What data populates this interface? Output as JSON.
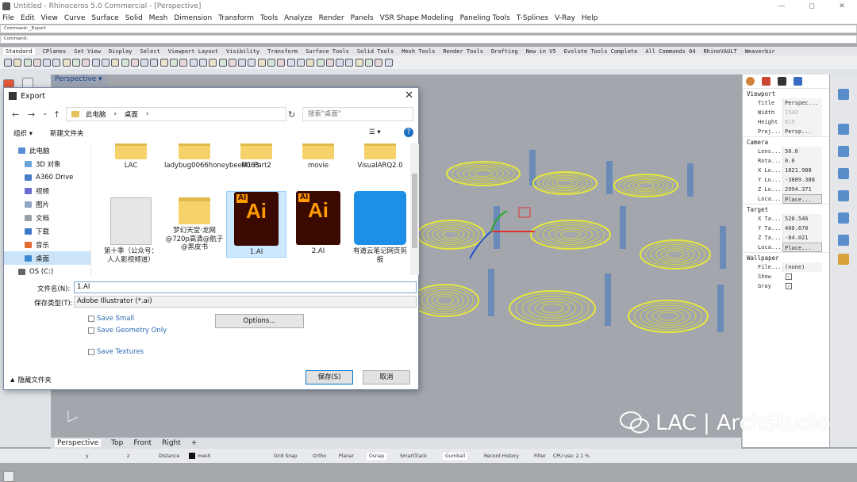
{
  "window": {
    "title": "Untitled - Rhinoceros 5.0 Commercial - [Perspective]",
    "controls": [
      "—",
      "◻",
      "✕"
    ]
  },
  "menu": [
    "File",
    "Edit",
    "View",
    "Curve",
    "Surface",
    "Solid",
    "Mesh",
    "Dimension",
    "Transform",
    "Tools",
    "Analyze",
    "Render",
    "Panels",
    "VSR Shape Modeling",
    "Paneling Tools",
    "T-Splines",
    "V-Ray",
    "Help"
  ],
  "command_history": "Command: _Export",
  "command_prompt": "Command:",
  "toolbar_tabs": [
    "Standard",
    "CPlanes",
    "Set View",
    "Display",
    "Select",
    "Viewport Layout",
    "Visibility",
    "Transform",
    "Surface Tools",
    "Solid Tools",
    "Mesh Tools",
    "Render Tools",
    "Drafting",
    "New in V5",
    "Evolute Tools Complete",
    "All Commands 04",
    "RhinoVAULT",
    "Weaverbir"
  ],
  "viewport": {
    "label": "Perspective",
    "dropdown": "▾"
  },
  "viewport_tabs": [
    "Perspective",
    "Top",
    "Front",
    "Right",
    "+"
  ],
  "dialog": {
    "title": "Export",
    "close": "✕",
    "nav": [
      "←",
      "→",
      "⌄",
      "↑"
    ],
    "address": [
      "此电脑",
      "›",
      "桌面",
      "›"
    ],
    "refresh": "↻",
    "search_placeholder": "搜索\"桌面\"",
    "organize": "组织 ▾",
    "new_folder": "新建文件夹",
    "view_icon": "☰ ▾",
    "help": "?",
    "nav_items": [
      "此电脑",
      "3D 对象",
      "A360 Drive",
      "视频",
      "图片",
      "文档",
      "下载",
      "音乐",
      "桌面",
      "OS (C:)"
    ],
    "files": [
      "LAC",
      "ladybug0066honeybee0063",
      "M1 Part2",
      "movie",
      "VisualARQ2.0",
      "第十季（公众号：人人影视频道）",
      "梦幻天堂·龙网@720p高清@航子@黑皮书",
      "1.AI",
      "2.AI",
      "有道云笔记网页剪报"
    ],
    "ai_label": "Ai",
    "ai_tag": "AI",
    "filename_label": "文件名(N):",
    "filename": "1.AI",
    "filetype_label": "保存类型(T):",
    "filetype": "Adobe Illustrator (*.ai)",
    "save_small": "Save Small",
    "save_geometry_only": "Save Geometry Only",
    "save_textures": "Save Textures",
    "options": "Options...",
    "hide_folders": "隐藏文件夹",
    "save": "保存(S)",
    "cancel": "取消"
  },
  "properties": {
    "viewport_header": "Viewport",
    "viewport": [
      [
        "Title",
        "Perspec..."
      ],
      [
        "Width",
        "1542"
      ],
      [
        "Height",
        "815"
      ],
      [
        "Proj...",
        "Persp..."
      ]
    ],
    "camera_header": "Camera",
    "camera": [
      [
        "Lens...",
        "50.0"
      ],
      [
        "Rota...",
        "0.0"
      ],
      [
        "X Lo...",
        "1821.988"
      ],
      [
        "Y Lo...",
        "-3889.388"
      ],
      [
        "Z Lo...",
        "2994.371"
      ],
      [
        "Loca...",
        "Place..."
      ]
    ],
    "target_header": "Target",
    "target": [
      [
        "X Ta...",
        "520.546"
      ],
      [
        "Y Ta...",
        "400.670"
      ],
      [
        "Z Ta...",
        "-84.021"
      ],
      [
        "Loca...",
        "Place..."
      ]
    ],
    "wallpaper_header": "Wallpaper",
    "wallpaper": [
      [
        "File...",
        "(none)"
      ],
      [
        "Show",
        "✓"
      ],
      [
        "Gray",
        "✓"
      ]
    ]
  },
  "status": {
    "y": "y",
    "z": "z",
    "distance": "Distance",
    "layer": "mesh",
    "items": [
      "Grid Snap",
      "Ortho",
      "Planar",
      "Osnap",
      "SmartTrack",
      "Gumball",
      "Record History",
      "Filter",
      "CPU use: 2.1 %"
    ]
  },
  "watermark": "LAC | ArchStudio",
  "colors": {
    "accent": "#0078d7",
    "folder": "#f6d26a",
    "ai_bg": "#3a0a00",
    "ai_text": "#ff9a00",
    "ring": "#e6e83a",
    "viewport": "#a3a7ad"
  }
}
